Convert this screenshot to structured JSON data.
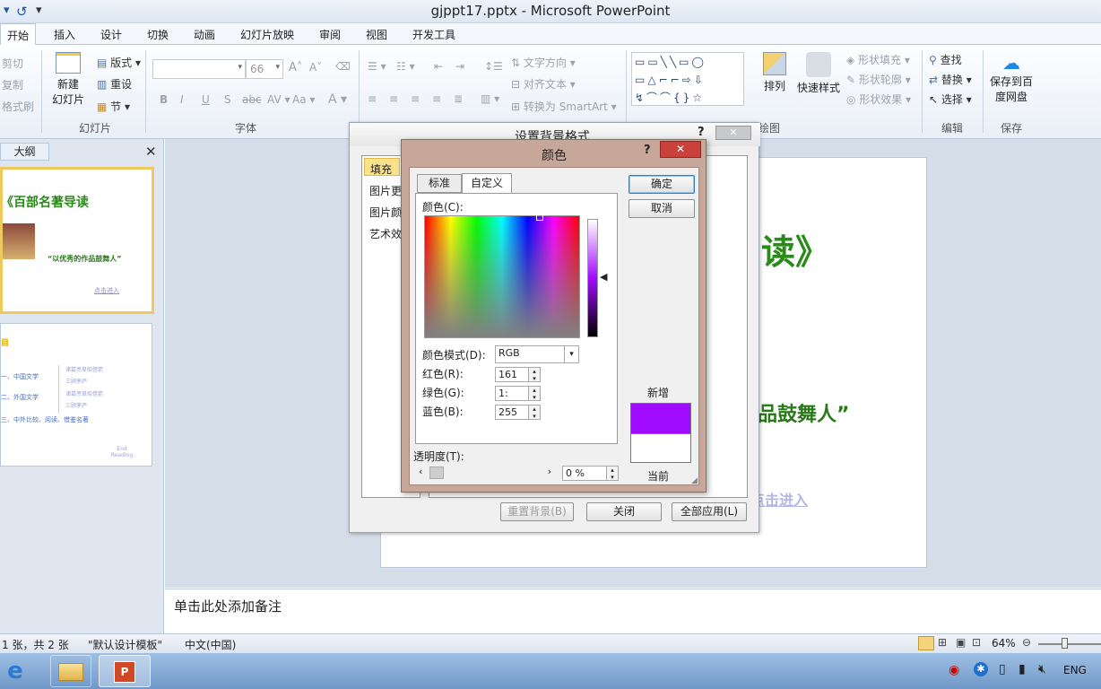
{
  "window": {
    "title": "gjppt17.pptx - Microsoft PowerPoint"
  },
  "ribbon_tabs": [
    "开始",
    "插入",
    "设计",
    "切换",
    "动画",
    "幻灯片放映",
    "审阅",
    "视图",
    "开发工具"
  ],
  "ribbon": {
    "clipboard": {
      "cut": "剪切",
      "copy": "复制",
      "format_painter": "格式刷",
      "group": "幻灯片"
    },
    "slides": {
      "new_slide_line1": "新建",
      "new_slide_line2": "幻灯片",
      "layout": "版式",
      "reset": "重设",
      "section": "节"
    },
    "font": {
      "size": "66",
      "group": "字体"
    },
    "paragraph": {
      "text_direction": "文字方向",
      "align_text": "对齐文本",
      "convert_smartart": "转换为 SmartArt"
    },
    "drawing": {
      "arrange": "排列",
      "quick_styles": "快速样式",
      "shape_fill": "形状填充",
      "shape_outline": "形状轮廓",
      "shape_effects": "形状效果",
      "group": "绘图"
    },
    "editing": {
      "find": "查找",
      "replace": "替换",
      "select": "选择",
      "group": "编辑"
    },
    "save": {
      "line1": "保存到百",
      "line2": "度网盘",
      "group": "保存"
    }
  },
  "left_panel": {
    "tab": "大纲",
    "slide1": {
      "title": "《百部名著导读",
      "subtitle": "“以优秀的作品鼓舞人”",
      "link": "点击进入"
    },
    "slide2": {
      "heading": "目",
      "items": [
        "一、中国文学",
        "二、外国文学",
        "三、中外比较、阅读、借鉴名著"
      ],
      "links": [
        "诸葛亮草船借箭",
        "三顾茅庐",
        "诸葛亮草船借箭",
        "三顾茅庐"
      ],
      "footer": "End Reading"
    }
  },
  "slide": {
    "title_fragment": "读》",
    "subtitle_fragment": "品鼓舞人”",
    "link_fragment": "点击进入"
  },
  "notes_placeholder": "单击此处添加备注",
  "status": {
    "slide_info": "1 张，共 2 张",
    "theme": "\"默认设计模板\"",
    "language": "中文(中国)",
    "zoom": "64%"
  },
  "bg_dialog": {
    "title": "设置背景格式",
    "help": "?",
    "categories": [
      "填充",
      "图片更",
      "图片颜",
      "艺术效"
    ],
    "buttons": {
      "reset": "重置背景(B)",
      "close": "关闭",
      "apply_all": "全部应用(L)"
    }
  },
  "color_dialog": {
    "title": "颜色",
    "help": "?",
    "tabs": [
      "标准",
      "自定义"
    ],
    "active_tab": "自定义",
    "colors_label": "颜色(C):",
    "model_label": "颜色模式(D):",
    "model_value": "RGB",
    "red_label": "红色(R):",
    "red_value": "161",
    "green_label": "绿色(G):",
    "green_value": "1:",
    "blue_label": "蓝色(B):",
    "blue_value": "255",
    "transparency_label": "透明度(T):",
    "transparency_value": "0 %",
    "ok": "确定",
    "cancel": "取消",
    "new_label": "新增",
    "current_label": "当前",
    "new_color": "#a10bff",
    "current_color": "#ffffff"
  },
  "taskbar": {
    "lang": "ENG"
  }
}
